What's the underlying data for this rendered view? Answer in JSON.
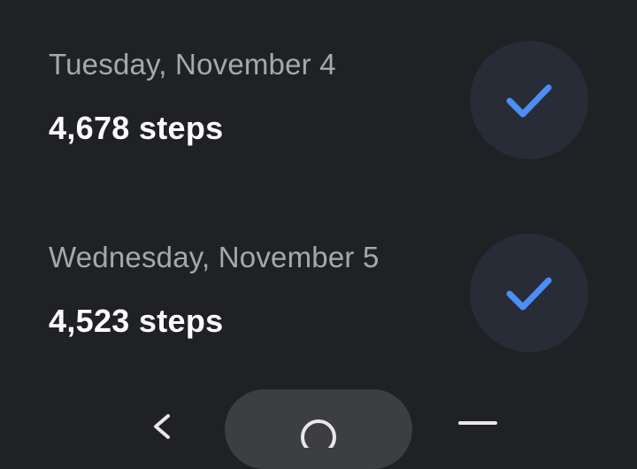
{
  "entries": [
    {
      "date": "Tuesday, November 4",
      "steps": "4,678 steps",
      "status_icon": "checkmark-icon"
    },
    {
      "date": "Wednesday, November 5",
      "steps": "4,523 steps",
      "status_icon": "checkmark-icon"
    }
  ],
  "colors": {
    "background": "#202124",
    "secondary_text": "#a6a8ab",
    "primary_text": "#ffffff",
    "check_circle": "#282c37",
    "check_accent": "#4c8df6",
    "nav_pill": "#3d3e42"
  },
  "navigation": {
    "buttons": [
      "back-icon",
      "home-icon",
      "menu-icon"
    ]
  }
}
